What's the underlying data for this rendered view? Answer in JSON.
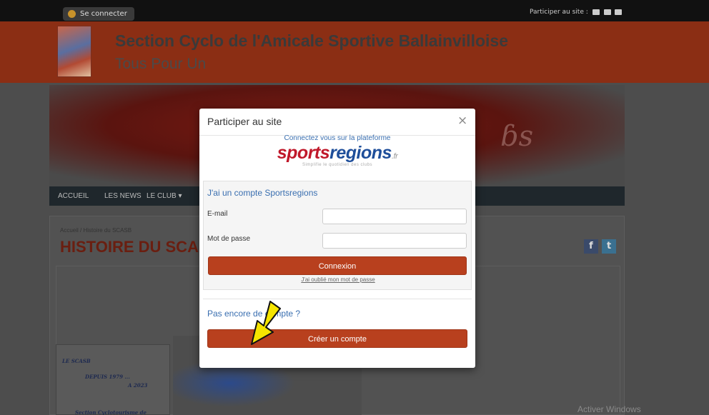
{
  "topbar": {
    "connect_label": "Se connecter",
    "participer_label": "Participer au site :"
  },
  "header": {
    "title": "Section Cyclo de l'Amicale Sportive Ballainvilloise",
    "subtitle": "Tous Pour Un"
  },
  "nav": {
    "items": [
      "ACCUEIL",
      "LES NEWS",
      "LE CLUB ▾"
    ]
  },
  "content": {
    "breadcrumb_home": "Accueil",
    "breadcrumb_sep": "/",
    "breadcrumb_current": "Histoire du SCASB",
    "page_title": "HISTOIRE DU SCAS",
    "poster_line1": "LE SCASB",
    "poster_line2": "DEPUIS 1979 ...",
    "poster_line3": "A 2023",
    "poster_line4": "Section Cyclotourisme de"
  },
  "modal": {
    "title": "Participer au site",
    "close": "×",
    "brand_intro": "Connectez vous sur la plateforme",
    "brand_sports": "sports",
    "brand_regions": "regions",
    "brand_fr": ".fr",
    "brand_tagline": "Simplifie le quotidien des clubs",
    "login_heading": "J'ai un compte Sportsregions",
    "email_label": "E-mail",
    "email_value": "",
    "password_label": "Mot de passe",
    "password_value": "",
    "login_button": "Connexion",
    "forgot_link": "J'ai oublié mon mot de passe",
    "no_account_text": "Pas encore de compte ?",
    "create_button": "Créer un compte"
  },
  "social": {
    "facebook": "f",
    "twitter": "t"
  },
  "watermark": "Activer Windows",
  "colors": {
    "accent_red": "#b8401e",
    "header_red": "#8b2e14",
    "link_blue": "#3a6fb0",
    "arrow_yellow": "#f5e400"
  }
}
